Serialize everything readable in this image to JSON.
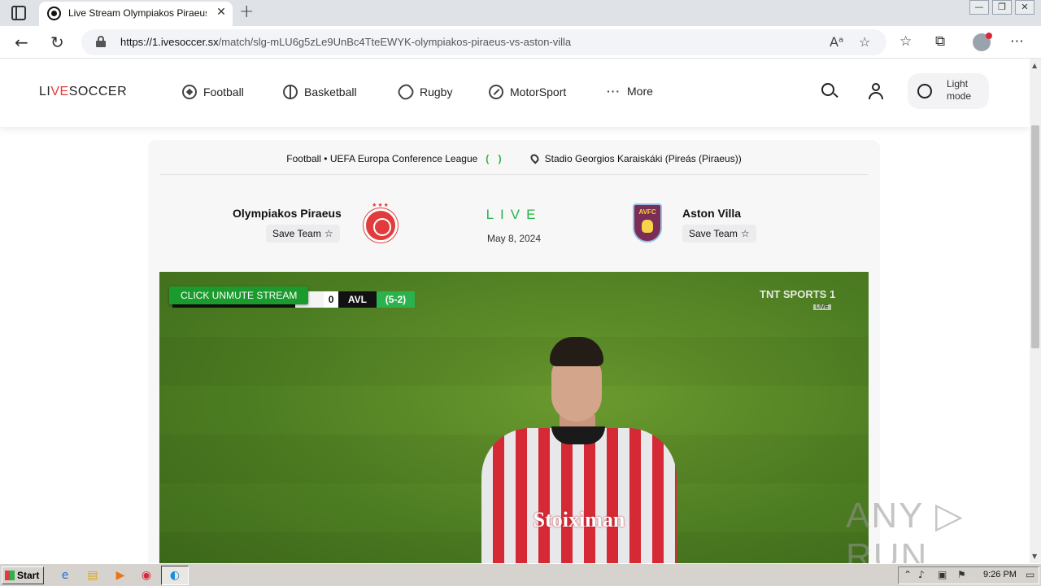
{
  "browser": {
    "tab_title": "Live Stream Olympiakos Piraeus vs Aston Villa",
    "tab_close": "✕",
    "new_tab": "+",
    "url_host": "https://1.ivesoccer.sx",
    "url_path": "/match/slg-mLU6g5zLe9UnBc4TteEWYK-olympiakos-piraeus-vs-aston-villa",
    "window_controls": [
      "—",
      "❐",
      "✕"
    ]
  },
  "site": {
    "logo_pre": "LI",
    "logo_accent": "VE",
    "logo_post": "SOCCER",
    "nav": [
      {
        "label": "Football",
        "icon": "football-icon"
      },
      {
        "label": "Basketball",
        "icon": "basketball-icon"
      },
      {
        "label": "Rugby",
        "icon": "rugby-icon"
      },
      {
        "label": "MotorSport",
        "icon": "motorsport-icon"
      },
      {
        "label": "More",
        "icon": "more-dots-icon"
      }
    ],
    "mode_label": "Light mode"
  },
  "match": {
    "breadcrumb": "Football • UEFA Europa Conference League",
    "breadcrumb_paren": "( )",
    "venue": "Stadio Georgios Karaiskáki (Pireás (Piraeus))",
    "home_team": "Olympiakos Piraeus",
    "away_team": "Aston Villa",
    "save_label": "Save Team",
    "status": "LIVE",
    "date": "May 8, 2024",
    "away_crest_text": "AVFC"
  },
  "video": {
    "unmute_label": "CLICK UNMUTE STREAM",
    "score": "0",
    "team_abbr": "AVL",
    "aggregate": "(5-2)",
    "broadcaster": "TNT SPORTS 1",
    "broadcaster_live": "LIVE",
    "sponsor": "Stoiximan"
  },
  "watermark": "ANY ▷ RUN",
  "taskbar": {
    "start_label": "Start",
    "clock": "9:26 PM"
  },
  "colors": {
    "accent_green": "#2bb24c",
    "brand_red": "#e23b3b",
    "villa_claret": "#7b2d56"
  }
}
